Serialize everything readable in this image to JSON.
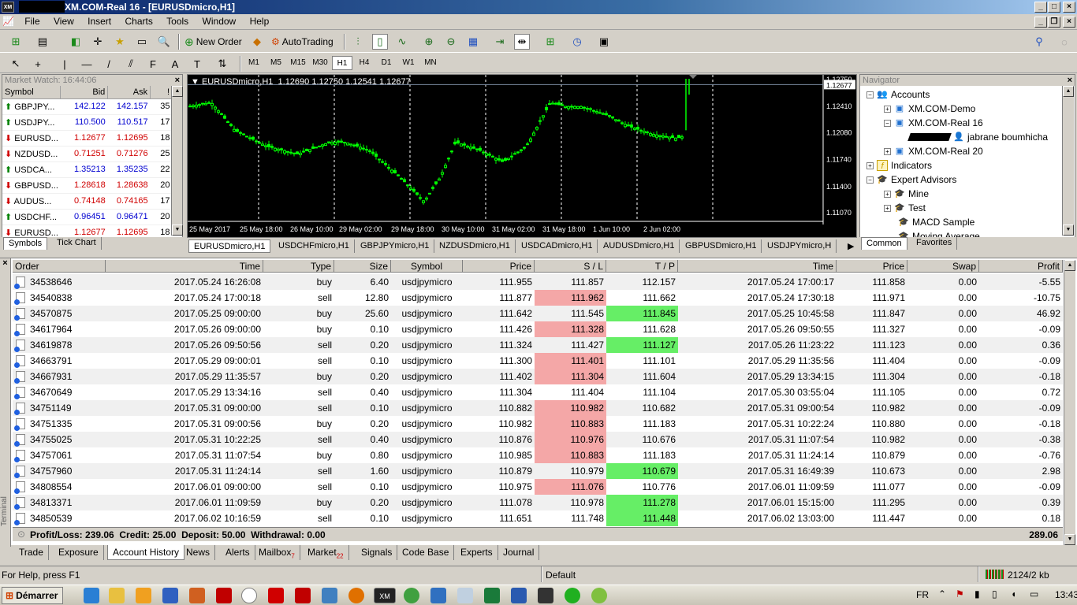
{
  "window": {
    "title": "XM.COM-Real 16 - [EURUSDmicro,H1]"
  },
  "menu": [
    "File",
    "View",
    "Insert",
    "Charts",
    "Tools",
    "Window",
    "Help"
  ],
  "toolbar": {
    "new_order": "New Order",
    "autotrading": "AutoTrading",
    "timeframes": [
      "M1",
      "M5",
      "M15",
      "M30",
      "H1",
      "H4",
      "D1",
      "W1",
      "MN"
    ],
    "active_tf": "H1"
  },
  "market_watch": {
    "title": "Market Watch: 16:44:06",
    "headers": [
      "Symbol",
      "Bid",
      "Ask",
      "!"
    ],
    "rows": [
      {
        "symbol": "GBPJPY...",
        "bid": "142.122",
        "ask": "142.157",
        "spread": "35",
        "dir": "up"
      },
      {
        "symbol": "USDJPY...",
        "bid": "110.500",
        "ask": "110.517",
        "spread": "17",
        "dir": "up"
      },
      {
        "symbol": "EURUSD...",
        "bid": "1.12677",
        "ask": "1.12695",
        "spread": "18",
        "dir": "dn"
      },
      {
        "symbol": "NZDUSD...",
        "bid": "0.71251",
        "ask": "0.71276",
        "spread": "25",
        "dir": "dn"
      },
      {
        "symbol": "USDCA...",
        "bid": "1.35213",
        "ask": "1.35235",
        "spread": "22",
        "dir": "up"
      },
      {
        "symbol": "GBPUSD...",
        "bid": "1.28618",
        "ask": "1.28638",
        "spread": "20",
        "dir": "dn"
      },
      {
        "symbol": "AUDUS...",
        "bid": "0.74148",
        "ask": "0.74165",
        "spread": "17",
        "dir": "dn"
      },
      {
        "symbol": "USDCHF...",
        "bid": "0.96451",
        "ask": "0.96471",
        "spread": "20",
        "dir": "up"
      },
      {
        "symbol": "EURUSD...",
        "bid": "1.12677",
        "ask": "1.12695",
        "spread": "18",
        "dir": "dn"
      }
    ],
    "tabs": [
      "Symbols",
      "Tick Chart"
    ]
  },
  "chart": {
    "label": "EURUSDmicro,H1  1.12690 1.12750 1.12541 1.12677",
    "price_labels": [
      "1.12750",
      "1.12677",
      "1.12410",
      "1.12080",
      "1.11740",
      "1.11400",
      "1.11070"
    ],
    "time_labels": [
      "25 May 2017",
      "25 May 18:00",
      "26 May 10:00",
      "29 May 02:00",
      "29 May 18:00",
      "30 May 10:00",
      "31 May 02:00",
      "31 May 18:00",
      "1 Jun 10:00",
      "2 Jun 02:00"
    ],
    "tabs": [
      "EURUSDmicro,H1",
      "USDCHFmicro,H1",
      "GBPJPYmicro,H1",
      "NZDUSDmicro,H1",
      "USDCADmicro,H1",
      "AUDUSDmicro,H1",
      "GBPUSDmicro,H1",
      "USDJPYmicro,H"
    ],
    "colors": {
      "bull": "#00ff00",
      "bg": "#000000",
      "grid": "#ffffff"
    }
  },
  "navigator": {
    "title": "Navigator",
    "items": [
      {
        "label": "Accounts"
      },
      {
        "label": "XM.COM-Demo"
      },
      {
        "label": "XM.COM-Real 16"
      },
      {
        "label": "jabrane boumhicha"
      },
      {
        "label": "XM.COM-Real 20"
      },
      {
        "label": "Indicators"
      },
      {
        "label": "Expert Advisors"
      },
      {
        "label": "Mine"
      },
      {
        "label": "Test"
      },
      {
        "label": "MACD Sample"
      },
      {
        "label": "Moving Average"
      }
    ],
    "tabs": [
      "Common",
      "Favorites"
    ]
  },
  "terminal": {
    "headers": [
      "Order",
      "Time",
      "Type",
      "Size",
      "Symbol",
      "Price",
      "S / L",
      "T / P",
      "Time",
      "Price",
      "Swap",
      "Profit"
    ],
    "rows": [
      [
        "34538646",
        "2017.05.24 16:26:08",
        "buy",
        "6.40",
        "usdjpymicro",
        "111.955",
        "111.857",
        "112.157",
        "2017.05.24 17:00:17",
        "111.858",
        "0.00",
        "-5.55"
      ],
      [
        "34540838",
        "2017.05.24 17:00:18",
        "sell",
        "12.80",
        "usdjpymicro",
        "111.877",
        "111.962",
        "111.662",
        "2017.05.24 17:30:18",
        "111.971",
        "0.00",
        "-10.75"
      ],
      [
        "34570875",
        "2017.05.25 09:00:00",
        "buy",
        "25.60",
        "usdjpymicro",
        "111.642",
        "111.545",
        "111.845",
        "2017.05.25 10:45:58",
        "111.847",
        "0.00",
        "46.92"
      ],
      [
        "34617964",
        "2017.05.26 09:00:00",
        "buy",
        "0.10",
        "usdjpymicro",
        "111.426",
        "111.328",
        "111.628",
        "2017.05.26 09:50:55",
        "111.327",
        "0.00",
        "-0.09"
      ],
      [
        "34619878",
        "2017.05.26 09:50:56",
        "sell",
        "0.20",
        "usdjpymicro",
        "111.324",
        "111.427",
        "111.127",
        "2017.05.26 11:23:22",
        "111.123",
        "0.00",
        "0.36"
      ],
      [
        "34663791",
        "2017.05.29 09:00:01",
        "sell",
        "0.10",
        "usdjpymicro",
        "111.300",
        "111.401",
        "111.101",
        "2017.05.29 11:35:56",
        "111.404",
        "0.00",
        "-0.09"
      ],
      [
        "34667931",
        "2017.05.29 11:35:57",
        "buy",
        "0.20",
        "usdjpymicro",
        "111.402",
        "111.304",
        "111.604",
        "2017.05.29 13:34:15",
        "111.304",
        "0.00",
        "-0.18"
      ],
      [
        "34670649",
        "2017.05.29 13:34:16",
        "sell",
        "0.40",
        "usdjpymicro",
        "111.304",
        "111.404",
        "111.104",
        "2017.05.30 03:55:04",
        "111.105",
        "0.00",
        "0.72"
      ],
      [
        "34751149",
        "2017.05.31 09:00:00",
        "sell",
        "0.10",
        "usdjpymicro",
        "110.882",
        "110.982",
        "110.682",
        "2017.05.31 09:00:54",
        "110.982",
        "0.00",
        "-0.09"
      ],
      [
        "34751335",
        "2017.05.31 09:00:56",
        "buy",
        "0.20",
        "usdjpymicro",
        "110.982",
        "110.883",
        "111.183",
        "2017.05.31 10:22:24",
        "110.880",
        "0.00",
        "-0.18"
      ],
      [
        "34755025",
        "2017.05.31 10:22:25",
        "sell",
        "0.40",
        "usdjpymicro",
        "110.876",
        "110.976",
        "110.676",
        "2017.05.31 11:07:54",
        "110.982",
        "0.00",
        "-0.38"
      ],
      [
        "34757061",
        "2017.05.31 11:07:54",
        "buy",
        "0.80",
        "usdjpymicro",
        "110.985",
        "110.883",
        "111.183",
        "2017.05.31 11:24:14",
        "110.879",
        "0.00",
        "-0.76"
      ],
      [
        "34757960",
        "2017.05.31 11:24:14",
        "sell",
        "1.60",
        "usdjpymicro",
        "110.879",
        "110.979",
        "110.679",
        "2017.05.31 16:49:39",
        "110.673",
        "0.00",
        "2.98"
      ],
      [
        "34808554",
        "2017.06.01 09:00:00",
        "sell",
        "0.10",
        "usdjpymicro",
        "110.975",
        "111.076",
        "110.776",
        "2017.06.01 11:09:59",
        "111.077",
        "0.00",
        "-0.09"
      ],
      [
        "34813371",
        "2017.06.01 11:09:59",
        "buy",
        "0.20",
        "usdjpymicro",
        "111.078",
        "110.978",
        "111.278",
        "2017.06.01 15:15:00",
        "111.295",
        "0.00",
        "0.39"
      ],
      [
        "34850539",
        "2017.06.02 10:16:59",
        "sell",
        "0.10",
        "usdjpymicro",
        "111.651",
        "111.748",
        "111.448",
        "2017.06.02 13:03:00",
        "111.447",
        "0.00",
        "0.18"
      ]
    ],
    "sl_hit": [
      false,
      true,
      false,
      true,
      false,
      true,
      true,
      false,
      true,
      true,
      true,
      true,
      false,
      true,
      false,
      false
    ],
    "tp_hit": [
      false,
      false,
      true,
      false,
      true,
      false,
      false,
      false,
      false,
      false,
      false,
      false,
      true,
      false,
      true,
      true
    ],
    "summary": "Profit/Loss: 239.06  Credit: 25.00  Deposit: 50.00  Withdrawal: 0.00",
    "total": "289.06",
    "side_label": "Terminal",
    "tabs": [
      {
        "label": "Trade",
        "badge": ""
      },
      {
        "label": "Exposure",
        "badge": ""
      },
      {
        "label": "Account History",
        "badge": ""
      },
      {
        "label": "News",
        "badge": ""
      },
      {
        "label": "Alerts",
        "badge": ""
      },
      {
        "label": "Mailbox",
        "badge": "7"
      },
      {
        "label": "Market",
        "badge": "22"
      },
      {
        "label": "Signals",
        "badge": ""
      },
      {
        "label": "Code Base",
        "badge": ""
      },
      {
        "label": "Experts",
        "badge": ""
      },
      {
        "label": "Journal",
        "badge": ""
      }
    ]
  },
  "status": {
    "help": "For Help, press F1",
    "profile": "Default",
    "traffic": "2124/2 kb"
  },
  "taskbar": {
    "start": "Démarrer",
    "lang": "FR",
    "clock": "13:43",
    "xm": "XM"
  }
}
